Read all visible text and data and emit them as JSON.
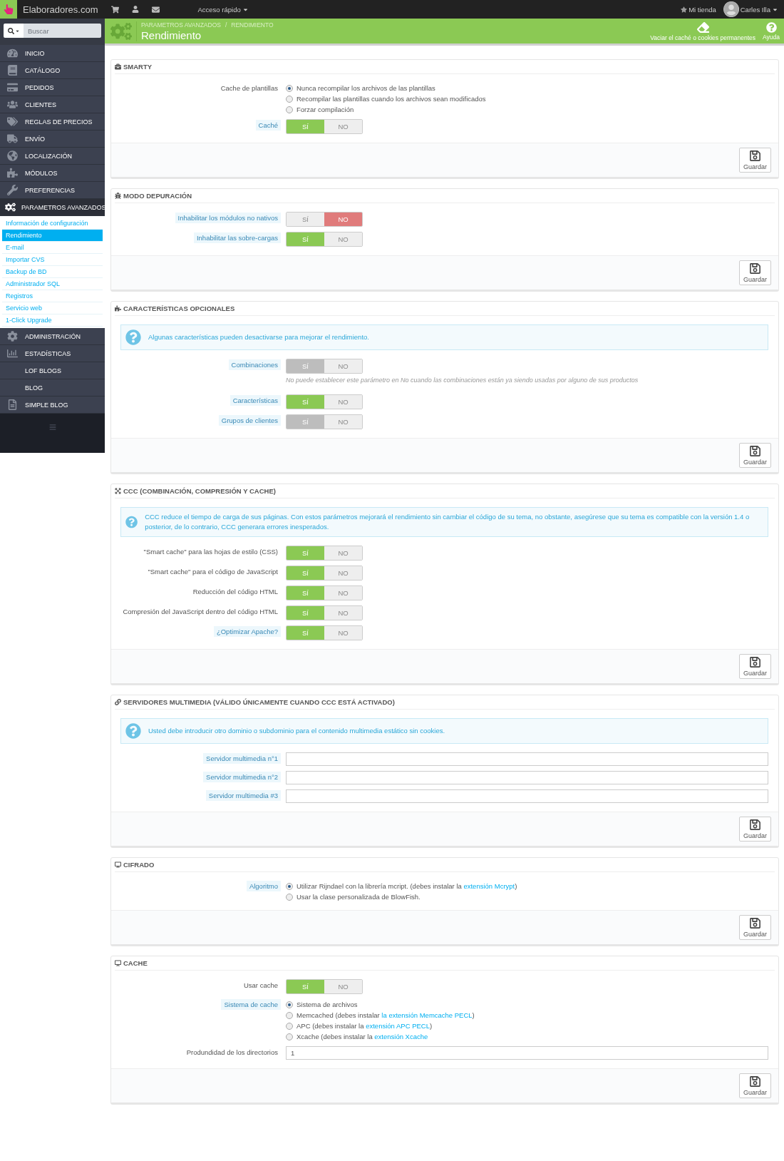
{
  "topbar": {
    "brand": "Elaboradores.com",
    "quick_access": "Acceso rápido",
    "shop": "Mi tienda",
    "user": "Carles Illa"
  },
  "sidebar": {
    "search": {
      "placeholder": "Buscar"
    },
    "menu": [
      {
        "label": "INICIO",
        "selected": false
      },
      {
        "label": "CATÁLOGO",
        "selected": false
      },
      {
        "label": "PEDIDOS",
        "selected": false
      },
      {
        "label": "CLIENTES",
        "selected": false
      },
      {
        "label": "REGLAS DE PRECIOS",
        "selected": false
      },
      {
        "label": "ENVÍO",
        "selected": false
      },
      {
        "label": "LOCALIZACIÓN",
        "selected": false
      },
      {
        "label": "MÓDULOS",
        "selected": false
      },
      {
        "label": "PREFERENCIAS",
        "selected": false
      },
      {
        "label": "PARAMETROS AVANZADOS",
        "selected": true,
        "children": [
          {
            "label": "Información de configuración",
            "selected": false
          },
          {
            "label": "Rendimiento",
            "selected": true
          },
          {
            "label": "E-mail",
            "selected": false
          },
          {
            "label": "Importar CVS",
            "selected": false
          },
          {
            "label": "Backup de BD",
            "selected": false
          },
          {
            "label": "Administrador SQL",
            "selected": false
          },
          {
            "label": "Registros",
            "selected": false
          },
          {
            "label": "Servicio web",
            "selected": false
          },
          {
            "label": "1-Click Upgrade",
            "selected": false
          }
        ]
      },
      {
        "label": "ADMINISTRACIÓN",
        "selected": false
      },
      {
        "label": "ESTADÍSTICAS",
        "selected": false
      },
      {
        "label": "LOF BLOGS",
        "selected": false
      },
      {
        "label": "BLOG",
        "selected": false
      },
      {
        "label": "SIMPLE BLOG",
        "selected": false
      }
    ]
  },
  "header": {
    "breadcrumb": [
      "PARAMETROS AVANZADOS",
      "RENDIMIENTO"
    ],
    "breadcrumb_separator": "/",
    "title": "Rendimiento",
    "actions": [
      "Vaciar el caché o cookies permanentes",
      "Ayuda"
    ]
  },
  "panels": [
    {
      "title": "SMARTY",
      "save": "Guardar",
      "rows": [
        {
          "kind": "radio",
          "label": "Cache de plantillas",
          "hint": false,
          "options": [
            {
              "text": "Nunca recompilar los archivos de las plantillas",
              "selected": true
            },
            {
              "text": "Recompilar las plantillas cuando los archivos sean modificados",
              "selected": false
            },
            {
              "text": "Forzar compilación",
              "selected": false
            }
          ]
        },
        {
          "kind": "toggle",
          "label": "Caché",
          "hint": true,
          "yes": "SÍ",
          "no": "NO",
          "on": true,
          "disabled": false
        }
      ]
    },
    {
      "title": "MODO DEPURACIÓN",
      "save": "Guardar",
      "rows": [
        {
          "kind": "toggle",
          "label": "Inhabilitar los módulos no nativos",
          "hint": true,
          "yes": "SÍ",
          "no": "NO",
          "on": false,
          "disabled": false
        },
        {
          "kind": "toggle",
          "label": "Inhabilitar las sobre-cargas",
          "hint": true,
          "yes": "SÍ",
          "no": "NO",
          "on": true,
          "disabled": false
        }
      ]
    },
    {
      "title": "CARACTERÍSTICAS OPCIONALES",
      "save": "Guardar",
      "info": "Algunas características pueden desactivarse para mejorar el rendimiento.",
      "rows": [
        {
          "kind": "toggle",
          "label": "Combinaciones",
          "hint": true,
          "yes": "SÍ",
          "no": "NO",
          "on": true,
          "disabled": true,
          "help": "No puede establecer este parámetro en No cuando las combinaciones están ya siendo usadas por alguno de sus productos"
        },
        {
          "kind": "toggle",
          "label": "Características",
          "hint": true,
          "yes": "SÍ",
          "no": "NO",
          "on": true,
          "disabled": false
        },
        {
          "kind": "toggle",
          "label": "Grupos de clientes",
          "hint": true,
          "yes": "SÍ",
          "no": "NO",
          "on": true,
          "disabled": true
        }
      ]
    },
    {
      "title": "CCC (COMBINACIÓN, COMPRESIÓN Y CACHE)",
      "save": "Guardar",
      "info": "CCC reduce el tiempo de carga de sus páginas. Con estos parámetros mejorará el rendimiento sin cambiar el código de su tema, no obstante, asegúrese que su tema es compatible con la versión 1.4 o posterior, de lo contrario, CCC generara errores inesperados.",
      "rows": [
        {
          "kind": "toggle",
          "label": "\"Smart cache\" para las hojas de estilo (CSS)",
          "hint": false,
          "yes": "SÍ",
          "no": "NO",
          "on": true,
          "disabled": false
        },
        {
          "kind": "toggle",
          "label": "\"Smart cache\" para el código de JavaScript",
          "hint": false,
          "yes": "SÍ",
          "no": "NO",
          "on": true,
          "disabled": false
        },
        {
          "kind": "toggle",
          "label": "Reducción del código HTML",
          "hint": false,
          "yes": "SÍ",
          "no": "NO",
          "on": true,
          "disabled": false
        },
        {
          "kind": "toggle",
          "label": "Compresión del JavaScript dentro del código HTML",
          "hint": false,
          "yes": "SÍ",
          "no": "NO",
          "on": true,
          "disabled": false
        },
        {
          "kind": "toggle",
          "label": "¿Optimizar Apache?",
          "hint": true,
          "yes": "SÍ",
          "no": "NO",
          "on": true,
          "disabled": false
        }
      ]
    },
    {
      "title": "SERVIDORES MULTIMEDIA (VÁLIDO ÚNICAMENTE CUANDO CCC ESTÁ ACTIVADO)",
      "save": "Guardar",
      "info": "Usted debe introducir otro dominio o subdominio para el contenido multimedia estático sin cookies.",
      "rows": [
        {
          "kind": "input",
          "label": "Servidor multimedia n°1",
          "hint": true
        },
        {
          "kind": "input",
          "label": "Servidor multimedia n°2",
          "hint": true
        },
        {
          "kind": "input",
          "label": "Servidor multimedia #3",
          "hint": true
        }
      ]
    },
    {
      "title": "CIFRADO",
      "save": "Guardar",
      "rows": [
        {
          "kind": "radio",
          "label": "Algoritmo",
          "hint": true,
          "options": [
            {
              "text": "Utilizar Rijndael con la librería mcript. (debes instalar la ",
              "link": "extensión Mcrypt",
              "after": ")",
              "selected": true
            },
            {
              "text": "Usar la clase personalizada de BlowFish.",
              "selected": false
            }
          ]
        }
      ]
    },
    {
      "title": "CACHE",
      "save": "Guardar",
      "rows": [
        {
          "kind": "toggle",
          "label": "Usar cache",
          "hint": false,
          "yes": "SÍ",
          "no": "NO",
          "on": true,
          "disabled": false
        },
        {
          "kind": "radio",
          "label": "Sistema de cache",
          "hint": true,
          "options": [
            {
              "text": "Sistema de archivos",
              "selected": true
            },
            {
              "text": "Memcached (debes instalar ",
              "link": "la extensión Memcache PECL",
              "after": ")",
              "selected": false
            },
            {
              "text": "APC (debes instalar la ",
              "link": "extensión APC PECL",
              "after": ")",
              "selected": false
            },
            {
              "text": "Xcache (debes instalar la ",
              "link": "extensión Xcache",
              "selected": false
            }
          ]
        },
        {
          "kind": "input",
          "label": "Produndidad de los directorios",
          "hint": false,
          "value": "1"
        }
      ]
    }
  ]
}
